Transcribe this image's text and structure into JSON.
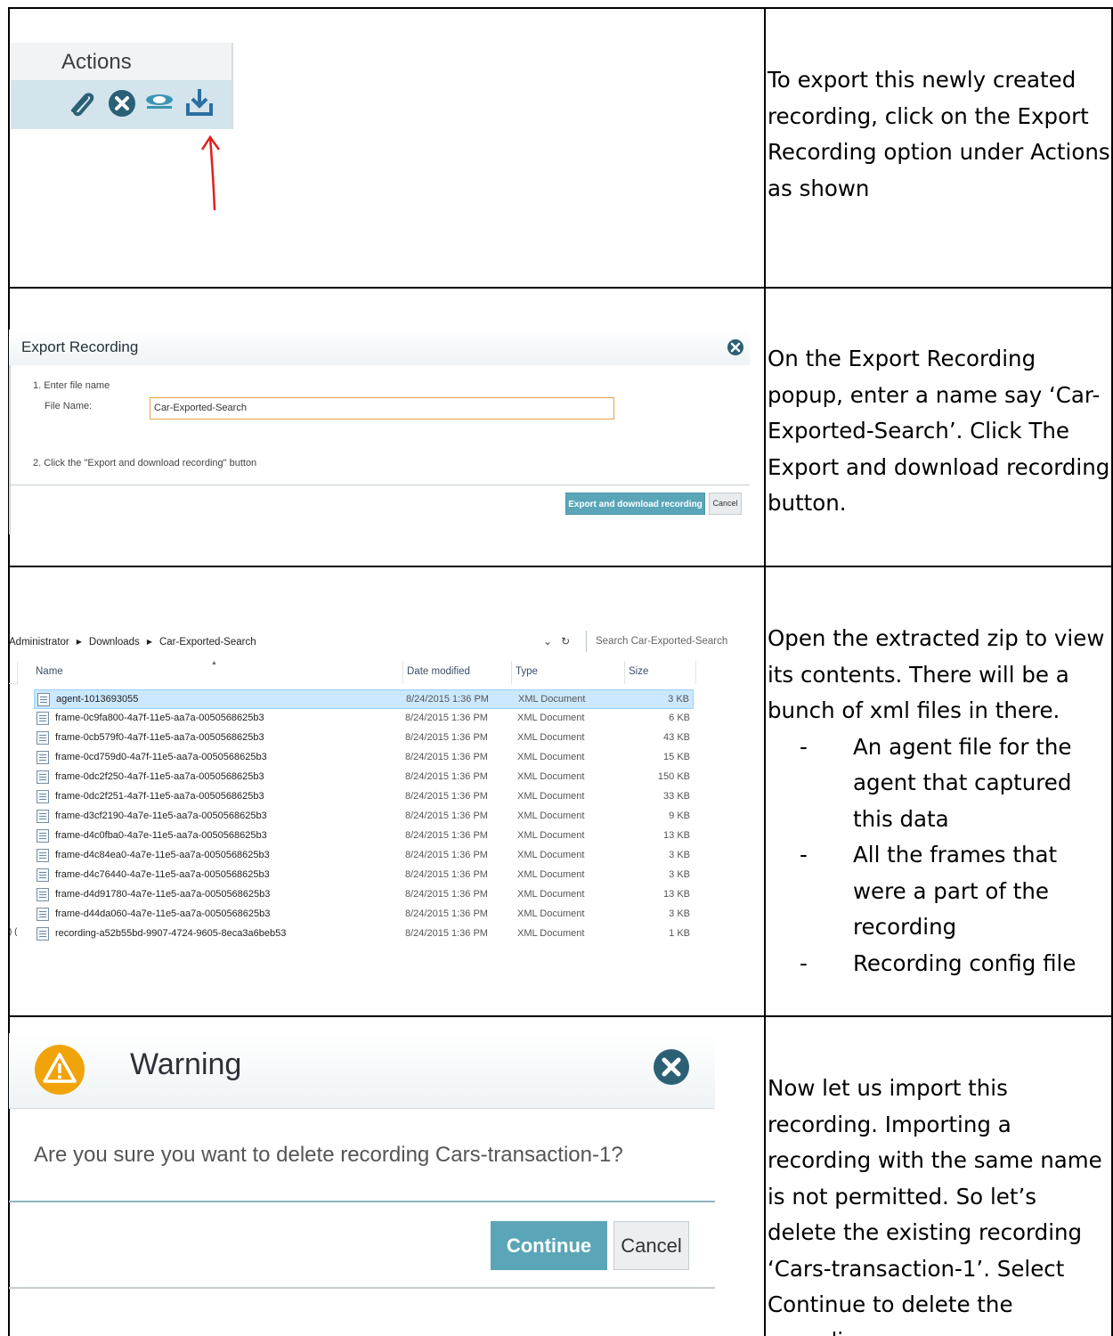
{
  "rows": [
    {
      "description": "To export this newly created recording, click on the Export Recording option under Actions as shown"
    },
    {
      "description": "On the Export Recording popup, enter a name say ‘Car-Exported-Search’. Click The Export and download recording button."
    },
    {
      "description": "Open the extracted zip to view its contents. There will be a bunch of xml files in there.",
      "bullets": [
        "An agent file for the agent that captured this data",
        "All the frames that were a part of the recording",
        "Recording config file"
      ]
    },
    {
      "description": "Now let us import this recording. Importing a recording with the same name is not permitted. So let’s delete the existing recording ‘Cars-transaction-1’. Select Continue to delete the recording"
    }
  ],
  "actions_panel": {
    "header": "Actions",
    "icons": [
      "attach-icon",
      "delete-icon",
      "view-icon",
      "export-download-icon"
    ],
    "arrow_color": "#e0201b"
  },
  "export_dialog": {
    "title": "Export Recording",
    "step1": "1. Enter file name",
    "file_name_label": "File Name:",
    "file_name_value": "Car-Exported-Search",
    "step2": "2. Click the \"Export and download recording\" button",
    "export_button": "Export and download recording",
    "cancel_button": "Cancel",
    "accent": "#5aa6b8"
  },
  "explorer": {
    "breadcrumb": [
      "Administrator",
      "Downloads",
      "Car-Exported-Search"
    ],
    "search_placeholder": "Search Car-Exported-Search",
    "columns": [
      "Name",
      "Date modified",
      "Type",
      "Size"
    ],
    "files": [
      {
        "name": "agent-1013693055",
        "date": "8/24/2015 1:36 PM",
        "type": "XML Document",
        "size": "3 KB",
        "selected": true
      },
      {
        "name": "frame-0c9fa800-4a7f-11e5-aa7a-0050568625b3",
        "date": "8/24/2015 1:36 PM",
        "type": "XML Document",
        "size": "6 KB"
      },
      {
        "name": "frame-0cb579f0-4a7f-11e5-aa7a-0050568625b3",
        "date": "8/24/2015 1:36 PM",
        "type": "XML Document",
        "size": "43 KB"
      },
      {
        "name": "frame-0cd759d0-4a7f-11e5-aa7a-0050568625b3",
        "date": "8/24/2015 1:36 PM",
        "type": "XML Document",
        "size": "15 KB"
      },
      {
        "name": "frame-0dc2f250-4a7f-11e5-aa7a-0050568625b3",
        "date": "8/24/2015 1:36 PM",
        "type": "XML Document",
        "size": "150 KB"
      },
      {
        "name": "frame-0dc2f251-4a7f-11e5-aa7a-0050568625b3",
        "date": "8/24/2015 1:36 PM",
        "type": "XML Document",
        "size": "33 KB"
      },
      {
        "name": "frame-d3cf2190-4a7e-11e5-aa7a-0050568625b3",
        "date": "8/24/2015 1:36 PM",
        "type": "XML Document",
        "size": "9 KB"
      },
      {
        "name": "frame-d4c0fba0-4a7e-11e5-aa7a-0050568625b3",
        "date": "8/24/2015 1:36 PM",
        "type": "XML Document",
        "size": "13 KB"
      },
      {
        "name": "frame-d4c84ea0-4a7e-11e5-aa7a-0050568625b3",
        "date": "8/24/2015 1:36 PM",
        "type": "XML Document",
        "size": "3 KB"
      },
      {
        "name": "frame-d4c76440-4a7e-11e5-aa7a-0050568625b3",
        "date": "8/24/2015 1:36 PM",
        "type": "XML Document",
        "size": "3 KB"
      },
      {
        "name": "frame-d4d91780-4a7e-11e5-aa7a-0050568625b3",
        "date": "8/24/2015 1:36 PM",
        "type": "XML Document",
        "size": "13 KB"
      },
      {
        "name": "frame-d44da060-4a7e-11e5-aa7a-0050568625b3",
        "date": "8/24/2015 1:36 PM",
        "type": "XML Document",
        "size": "3 KB"
      },
      {
        "name": "recording-a52b55bd-9907-4724-9605-8eca3a6beb53",
        "date": "8/24/2015 1:36 PM",
        "type": "XML Document",
        "size": "1 KB"
      }
    ]
  },
  "warning_dialog": {
    "title": "Warning",
    "message": "Are you sure you want to delete recording Cars-transaction-1?",
    "continue_button": "Continue",
    "cancel_button": "Cancel",
    "warning_color": "#f0a30a",
    "accent": "#5aa6b8"
  }
}
